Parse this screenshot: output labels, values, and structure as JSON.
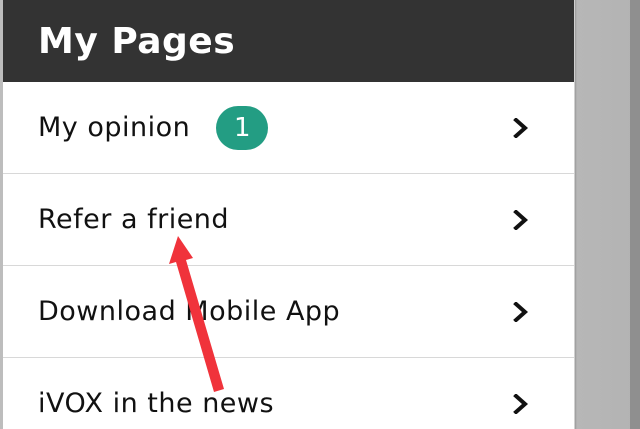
{
  "panel": {
    "title": "My Pages"
  },
  "menu": {
    "items": [
      {
        "label": "My opinion",
        "badge": "1",
        "icon": "chevron-right-icon"
      },
      {
        "label": "Refer a friend",
        "icon": "chevron-right-icon"
      },
      {
        "label": "Download Mobile App",
        "icon": "chevron-right-icon"
      },
      {
        "label": "iVOX in the news",
        "icon": "chevron-right-icon"
      }
    ]
  },
  "colors": {
    "header_bg": "#333333",
    "badge_bg": "#239d83",
    "annotation_arrow": "#f0333b"
  }
}
